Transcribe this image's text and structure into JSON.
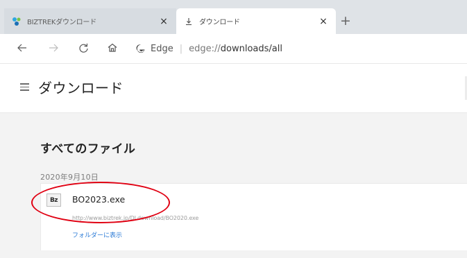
{
  "tabs": [
    {
      "label": "BIZTREKダウンロード",
      "close_label": "×",
      "favicon": "biztrek-favicon"
    },
    {
      "label": "ダウンロード",
      "close_label": "×",
      "favicon": "download-icon"
    }
  ],
  "tabstrip": {
    "new_tab_label": "+"
  },
  "toolbar": {
    "back_icon": "back-arrow-icon",
    "forward_icon": "forward-arrow-icon",
    "refresh_icon": "refresh-icon",
    "home_icon": "home-icon",
    "site_label": "Edge",
    "separator": "|",
    "url_base": "edge://",
    "url_path": "downloads/all"
  },
  "header": {
    "title": "ダウンロード",
    "menu_icon": "hamburger-icon"
  },
  "content": {
    "section_title": "すべてのファイル",
    "date_label": "2020年9月10日",
    "download": {
      "file_name": "BO2023.exe",
      "file_icon_text": "Bz",
      "url": "http://www.biztrek.jp/DLdownload/BO2020.exe",
      "show_in_folder": "フォルダーに表示"
    }
  },
  "colors": {
    "highlight": "#e00012",
    "link": "#2c7bd6",
    "tabstrip_bg": "#dfe3e7"
  }
}
